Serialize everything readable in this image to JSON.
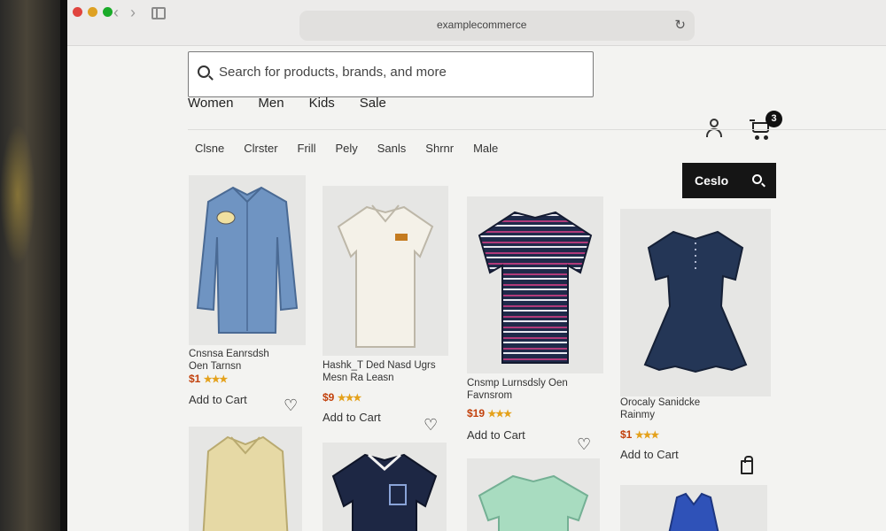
{
  "browser": {
    "url": "examplecommerce",
    "traffic_colors": [
      "#e0443e",
      "#dea123",
      "#1aab29"
    ]
  },
  "site": {
    "search_placeholder": "Search for products, brands, and more",
    "main_nav": [
      "Women",
      "Men",
      "Kids",
      "Sale"
    ],
    "sub_nav": [
      "Clsne",
      "Clrster",
      "Frill",
      "Pely",
      "Sanls",
      "Shrnr",
      "Male"
    ],
    "cart_count": "3",
    "search_button_label": "Ceslo"
  },
  "products": [
    {
      "name": "Cnsnsa Eanrsdsh Oen Tarnsn",
      "price": "$1",
      "stars": "★★★",
      "add": "Add to Cart",
      "shirt_color": "#6f94c2",
      "action_icon": "heart-icon"
    },
    {
      "name": "Hashk_T Ded Nasd Ugrs Mesn Ra Leasn",
      "price": "$9",
      "stars": "★★★",
      "add": "Add to Cart",
      "shirt_color": "#f4f1e8",
      "action_icon": "heart-icon"
    },
    {
      "name": "Cnsmp Lurnsdsly Oen Favnsrom",
      "price": "$19",
      "stars": "★★★",
      "add": "Add to Cart",
      "shirt_color": "#1f2a4a",
      "action_icon": "heart-icon"
    },
    {
      "name": "Orocaly Sanidcke Rainmy",
      "price": "$1",
      "stars": "★★★",
      "add": "Add to Cart",
      "shirt_color": "#243656",
      "action_icon": "bag-icon"
    },
    {
      "name": "",
      "price": "",
      "stars": "",
      "add": "",
      "shirt_color": "#e6d9a5",
      "action_icon": ""
    },
    {
      "name": "",
      "price": "",
      "stars": "",
      "add": "",
      "shirt_color": "#1d2744",
      "action_icon": ""
    },
    {
      "name": "",
      "price": "",
      "stars": "",
      "add": "",
      "shirt_color": "#a8dcc0",
      "action_icon": ""
    },
    {
      "name": "",
      "price": "",
      "stars": "",
      "add": "",
      "shirt_color": "#2f52b8",
      "action_icon": ""
    }
  ]
}
